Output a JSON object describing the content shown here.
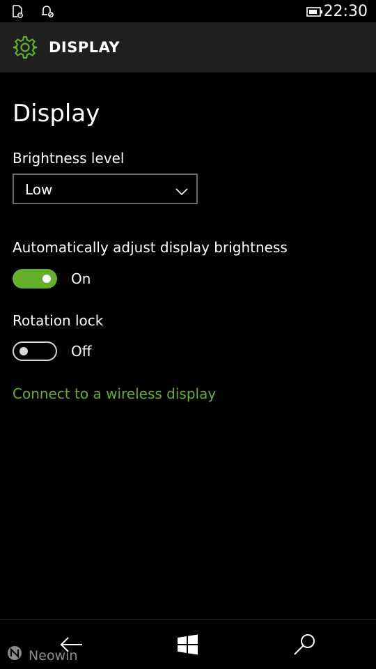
{
  "status_bar": {
    "time": "22:30",
    "icons": [
      "notification-icon",
      "quiet-hours-icon",
      "battery-icon"
    ]
  },
  "header": {
    "icon": "gear-icon",
    "title": "DISPLAY"
  },
  "page": {
    "title": "Display",
    "brightness": {
      "label": "Brightness level",
      "selected": "Low"
    },
    "auto_brightness": {
      "label": "Automatically adjust display brightness",
      "state_label": "On",
      "on": true
    },
    "rotation_lock": {
      "label": "Rotation lock",
      "state_label": "Off",
      "on": false
    },
    "wireless_link": "Connect to a wireless display"
  },
  "navbar": {
    "buttons": [
      "back-arrow-icon",
      "windows-logo-icon",
      "search-icon"
    ]
  },
  "watermark": {
    "text": "Neowin"
  },
  "colors": {
    "accent": "#63b12b",
    "background": "#000000",
    "header_bg": "#1f1f1f"
  }
}
